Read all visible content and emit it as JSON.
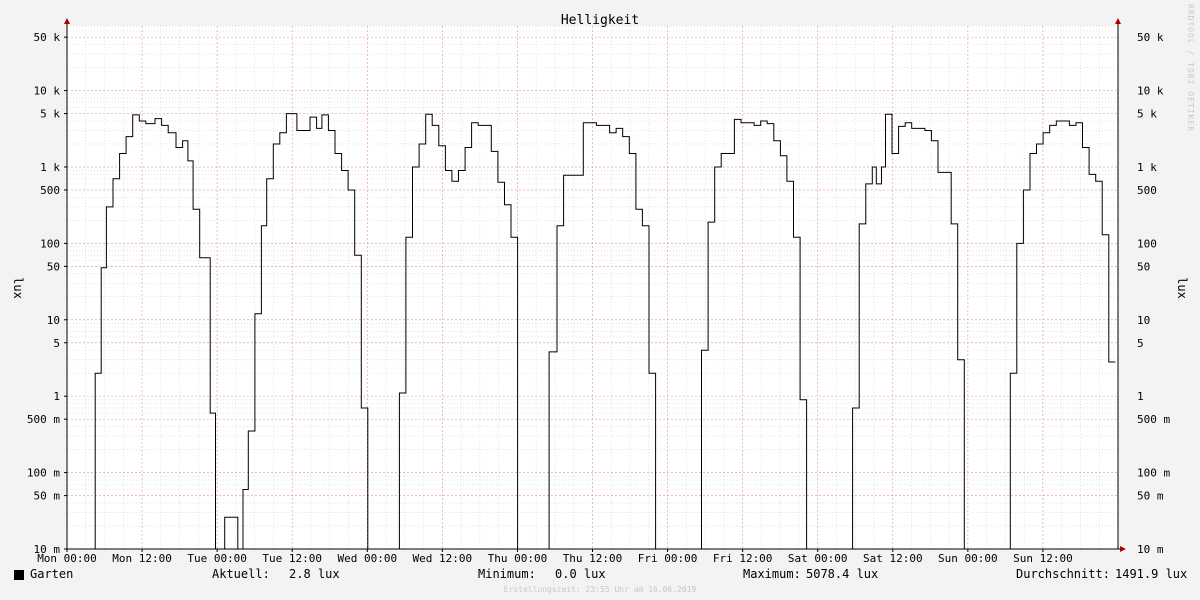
{
  "chart_data": {
    "type": "line",
    "title": "Helligkeit",
    "ylabel": "lux",
    "y_scale": "log",
    "ylim": [
      0.01,
      70000
    ],
    "y_ticks": [
      {
        "value": 0.01,
        "label": "10 m"
      },
      {
        "value": 0.05,
        "label": "50 m"
      },
      {
        "value": 0.1,
        "label": "100 m"
      },
      {
        "value": 0.5,
        "label": "500 m"
      },
      {
        "value": 1,
        "label": "1"
      },
      {
        "value": 5,
        "label": "5"
      },
      {
        "value": 10,
        "label": "10"
      },
      {
        "value": 50,
        "label": "50"
      },
      {
        "value": 100,
        "label": "100"
      },
      {
        "value": 500,
        "label": "500"
      },
      {
        "value": 1000,
        "label": "1 k"
      },
      {
        "value": 5000,
        "label": "5 k"
      },
      {
        "value": 10000,
        "label": "10 k"
      },
      {
        "value": 50000,
        "label": "50 k"
      }
    ],
    "x_range_hours": [
      0,
      168
    ],
    "x_ticks": [
      {
        "hours": 0,
        "label": "Mon 00:00"
      },
      {
        "hours": 12,
        "label": "Mon 12:00"
      },
      {
        "hours": 24,
        "label": "Tue 00:00"
      },
      {
        "hours": 36,
        "label": "Tue 12:00"
      },
      {
        "hours": 48,
        "label": "Wed 00:00"
      },
      {
        "hours": 60,
        "label": "Wed 12:00"
      },
      {
        "hours": 72,
        "label": "Thu 00:00"
      },
      {
        "hours": 84,
        "label": "Thu 12:00"
      },
      {
        "hours": 96,
        "label": "Fri 00:00"
      },
      {
        "hours": 108,
        "label": "Fri 12:00"
      },
      {
        "hours": 120,
        "label": "Sat 00:00"
      },
      {
        "hours": 132,
        "label": "Sat 12:00"
      },
      {
        "hours": 144,
        "label": "Sun 00:00"
      },
      {
        "hours": 156,
        "label": "Sun 12:00"
      }
    ],
    "grid": true,
    "series": [
      {
        "name": "Garten",
        "color": "#000000",
        "points": [
          [
            0.0,
            0.01
          ],
          [
            2.15,
            0.01
          ],
          [
            2.15,
            2.0
          ],
          [
            2.6,
            2.0
          ],
          [
            2.6,
            48
          ],
          [
            3.0,
            48
          ],
          [
            3.0,
            300
          ],
          [
            3.5,
            300
          ],
          [
            3.5,
            700
          ],
          [
            4.0,
            700
          ],
          [
            4.0,
            1500
          ],
          [
            4.5,
            1500
          ],
          [
            4.5,
            2500
          ],
          [
            5.0,
            2500
          ],
          [
            5.0,
            4800
          ],
          [
            5.5,
            4800
          ],
          [
            5.5,
            4000
          ],
          [
            6.0,
            4000
          ],
          [
            6.0,
            3700
          ],
          [
            6.7,
            3700
          ],
          [
            6.7,
            4300
          ],
          [
            7.2,
            4300
          ],
          [
            7.2,
            3500
          ],
          [
            7.7,
            3500
          ],
          [
            7.7,
            2800
          ],
          [
            8.3,
            2800
          ],
          [
            8.3,
            1800
          ],
          [
            8.8,
            1800
          ],
          [
            8.8,
            2200
          ],
          [
            9.2,
            2200
          ],
          [
            9.2,
            1200
          ],
          [
            9.6,
            1200
          ],
          [
            9.6,
            280
          ],
          [
            10.1,
            280
          ],
          [
            10.1,
            65
          ],
          [
            10.9,
            65
          ],
          [
            10.9,
            0.6
          ],
          [
            11.3,
            0.6
          ],
          [
            11.3,
            0.01
          ],
          [
            12.0,
            0.01
          ],
          [
            12.0,
            0.026
          ],
          [
            13.0,
            0.026
          ],
          [
            13.0,
            0.01
          ],
          [
            13.4,
            0.01
          ],
          [
            13.4,
            0.06
          ],
          [
            13.8,
            0.06
          ],
          [
            13.8,
            0.35
          ],
          [
            14.3,
            0.35
          ],
          [
            14.3,
            12
          ],
          [
            14.8,
            12
          ],
          [
            14.8,
            170
          ],
          [
            15.2,
            170
          ],
          [
            15.2,
            700
          ],
          [
            15.7,
            700
          ],
          [
            15.7,
            2000
          ],
          [
            16.2,
            2000
          ],
          [
            16.2,
            2800
          ],
          [
            16.7,
            2800
          ],
          [
            16.7,
            5000
          ],
          [
            17.5,
            5000
          ],
          [
            17.5,
            3000
          ],
          [
            18.5,
            3000
          ],
          [
            18.5,
            4500
          ],
          [
            19.0,
            4500
          ],
          [
            19.0,
            3200
          ],
          [
            19.4,
            3200
          ],
          [
            19.4,
            4800
          ],
          [
            19.9,
            4800
          ],
          [
            19.9,
            3000
          ],
          [
            20.4,
            3000
          ],
          [
            20.4,
            1500
          ],
          [
            20.9,
            1500
          ],
          [
            20.9,
            900
          ],
          [
            21.4,
            900
          ],
          [
            21.4,
            500
          ],
          [
            21.9,
            500
          ],
          [
            21.9,
            70
          ],
          [
            22.4,
            70
          ],
          [
            22.4,
            0.7
          ],
          [
            22.9,
            0.7
          ],
          [
            22.9,
            0.01
          ],
          [
            25.3,
            0.01
          ],
          [
            25.3,
            1.1
          ],
          [
            25.8,
            1.1
          ],
          [
            25.8,
            120
          ],
          [
            26.3,
            120
          ],
          [
            26.3,
            1000
          ],
          [
            26.8,
            1000
          ],
          [
            26.8,
            2000
          ],
          [
            27.3,
            2000
          ],
          [
            27.3,
            4900
          ],
          [
            27.8,
            4900
          ],
          [
            27.8,
            3500
          ],
          [
            28.3,
            3500
          ],
          [
            28.3,
            1900
          ],
          [
            28.8,
            1900
          ],
          [
            28.8,
            900
          ],
          [
            29.3,
            900
          ],
          [
            29.3,
            650
          ],
          [
            29.8,
            650
          ],
          [
            29.8,
            900
          ],
          [
            30.3,
            900
          ],
          [
            30.3,
            1800
          ],
          [
            30.8,
            1800
          ],
          [
            30.8,
            3800
          ],
          [
            31.3,
            3800
          ],
          [
            31.3,
            3500
          ],
          [
            32.3,
            3500
          ],
          [
            32.3,
            1600
          ],
          [
            32.8,
            1600
          ],
          [
            32.8,
            630
          ],
          [
            33.3,
            630
          ],
          [
            33.3,
            320
          ],
          [
            33.8,
            320
          ],
          [
            33.8,
            120
          ],
          [
            34.3,
            120
          ],
          [
            34.3,
            0.01
          ],
          [
            36.7,
            0.01
          ],
          [
            36.7,
            3.8
          ],
          [
            37.3,
            3.8
          ],
          [
            37.3,
            170
          ],
          [
            37.8,
            170
          ],
          [
            37.8,
            780
          ],
          [
            39.3,
            780
          ],
          [
            39.3,
            3800
          ],
          [
            40.3,
            3800
          ],
          [
            40.3,
            3500
          ],
          [
            41.3,
            3500
          ],
          [
            41.3,
            2800
          ],
          [
            41.8,
            2800
          ],
          [
            41.8,
            3200
          ],
          [
            42.3,
            3200
          ],
          [
            42.3,
            2500
          ],
          [
            42.8,
            2500
          ],
          [
            42.8,
            1500
          ],
          [
            43.3,
            1500
          ],
          [
            43.3,
            280
          ],
          [
            43.8,
            280
          ],
          [
            43.8,
            170
          ],
          [
            44.3,
            170
          ],
          [
            44.3,
            2.0
          ],
          [
            44.8,
            2.0
          ],
          [
            44.8,
            0.01
          ],
          [
            48.3,
            0.01
          ],
          [
            48.3,
            4.0
          ],
          [
            48.8,
            4.0
          ],
          [
            48.8,
            190
          ],
          [
            49.3,
            190
          ],
          [
            49.3,
            1000
          ],
          [
            49.8,
            1000
          ],
          [
            49.8,
            1500
          ],
          [
            50.8,
            1500
          ],
          [
            50.8,
            4200
          ],
          [
            51.3,
            4200
          ],
          [
            51.3,
            3800
          ],
          [
            52.3,
            3800
          ],
          [
            52.3,
            3500
          ],
          [
            52.8,
            3500
          ],
          [
            52.8,
            4000
          ],
          [
            53.3,
            4000
          ],
          [
            53.3,
            3700
          ],
          [
            53.8,
            3700
          ],
          [
            53.8,
            2200
          ],
          [
            54.3,
            2200
          ],
          [
            54.3,
            1400
          ],
          [
            54.8,
            1400
          ],
          [
            54.8,
            650
          ],
          [
            55.3,
            650
          ],
          [
            55.3,
            120
          ],
          [
            55.8,
            120
          ],
          [
            55.8,
            0.9
          ],
          [
            56.3,
            0.9
          ],
          [
            56.3,
            0.01
          ],
          [
            59.8,
            0.01
          ],
          [
            59.8,
            0.7
          ],
          [
            60.3,
            0.7
          ],
          [
            60.3,
            180
          ],
          [
            60.8,
            180
          ],
          [
            60.8,
            600
          ],
          [
            61.3,
            600
          ],
          [
            61.3,
            1000
          ],
          [
            61.6,
            1000
          ],
          [
            61.6,
            600
          ],
          [
            62.0,
            600
          ],
          [
            62.0,
            1000
          ],
          [
            62.3,
            1000
          ],
          [
            62.3,
            4900
          ],
          [
            62.8,
            4900
          ],
          [
            62.8,
            1500
          ],
          [
            63.3,
            1500
          ],
          [
            63.3,
            3400
          ],
          [
            63.8,
            3400
          ],
          [
            63.8,
            3800
          ],
          [
            64.3,
            3800
          ],
          [
            64.3,
            3200
          ],
          [
            65.3,
            3200
          ],
          [
            65.3,
            3000
          ],
          [
            65.8,
            3000
          ],
          [
            65.8,
            2200
          ],
          [
            66.3,
            2200
          ],
          [
            66.3,
            850
          ],
          [
            67.3,
            850
          ],
          [
            67.3,
            180
          ],
          [
            67.8,
            180
          ],
          [
            67.8,
            3.0
          ],
          [
            68.3,
            3.0
          ],
          [
            68.3,
            0.01
          ],
          [
            71.8,
            0.01
          ],
          [
            71.8,
            2.0
          ],
          [
            72.3,
            2.0
          ],
          [
            72.3,
            100
          ],
          [
            72.8,
            100
          ],
          [
            72.8,
            500
          ],
          [
            73.3,
            500
          ],
          [
            73.3,
            1500
          ],
          [
            73.8,
            1500
          ],
          [
            73.8,
            2000
          ],
          [
            74.3,
            2000
          ],
          [
            74.3,
            2800
          ],
          [
            74.8,
            2800
          ],
          [
            74.8,
            3500
          ],
          [
            75.3,
            3500
          ],
          [
            75.3,
            4000
          ],
          [
            76.3,
            4000
          ],
          [
            76.3,
            3500
          ],
          [
            76.8,
            3500
          ],
          [
            76.8,
            3800
          ],
          [
            77.3,
            3800
          ],
          [
            77.3,
            1800
          ],
          [
            77.8,
            1800
          ],
          [
            77.8,
            800
          ],
          [
            78.3,
            800
          ],
          [
            78.3,
            650
          ],
          [
            78.8,
            650
          ],
          [
            78.8,
            130
          ],
          [
            79.3,
            130
          ],
          [
            79.3,
            2.8
          ],
          [
            79.8,
            2.8
          ]
        ]
      }
    ],
    "x_scale_factor": 2.1,
    "legend": {
      "series_label": "Garten",
      "current_label": "Aktuell:",
      "current_value": "2.8 lux",
      "min_label": "Minimum:",
      "min_value": "0.0 lux",
      "max_label": "Maximum:",
      "max_value": "5078.4 lux",
      "avg_label": "Durchschnitt:",
      "avg_value": "1491.9 lux"
    },
    "timestamp": "Erstellungszeit: 23:55 Uhr am 16.06.2019",
    "watermark": "RRDTOOL / TOBI OETIKER"
  }
}
